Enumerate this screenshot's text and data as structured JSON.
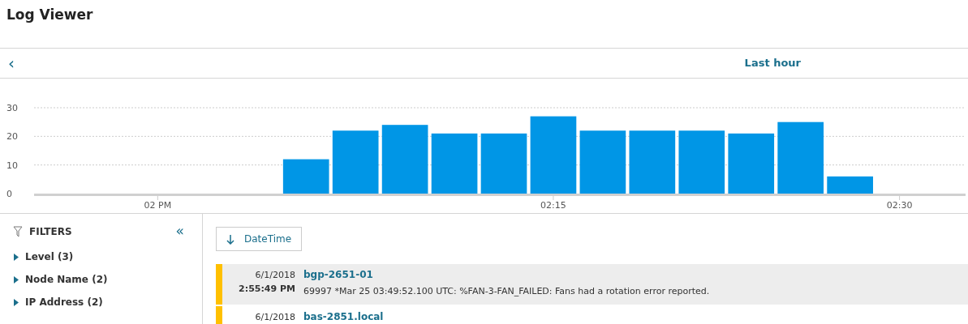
{
  "title": "Log Viewer",
  "range": {
    "back": "‹",
    "label": "Last hour"
  },
  "chart_data": {
    "type": "bar",
    "categories": [
      null,
      null,
      "02 PM",
      null,
      null,
      null,
      null,
      null,
      null,
      null,
      "02:15",
      null,
      null,
      null,
      null,
      null,
      null,
      "02:30",
      null
    ],
    "series": [
      {
        "color": "#0096e6",
        "values": [
          null,
          null,
          null,
          null,
          null,
          12,
          22,
          24,
          21,
          21,
          27,
          22,
          22,
          22,
          21,
          25,
          6,
          null,
          null
        ]
      }
    ],
    "ylim": [
      0,
      30
    ],
    "grid": true,
    "yticks": [
      0,
      10,
      20,
      30
    ]
  },
  "filters": {
    "title": "FILTERS",
    "collapse": "«",
    "items": [
      {
        "label": "Level (3)",
        "expanded": false
      },
      {
        "label": "Node Name (2)",
        "expanded": false
      },
      {
        "label": "IP Address (2)",
        "expanded": false
      }
    ]
  },
  "sort": {
    "label": "DateTime"
  },
  "logs": [
    {
      "date": "6/1/2018",
      "time": "2:55:49 PM",
      "node": "bgp-2651-01",
      "message": "69997 *Mar 25 03:49:52.100 UTC: %FAN-3-FAN_FAILED: Fans had a rotation error reported.",
      "color": "#ffc000",
      "selected": true
    },
    {
      "date": "6/1/2018",
      "node": "bas-2851.local",
      "color": "#ffc000",
      "selected": false
    }
  ]
}
